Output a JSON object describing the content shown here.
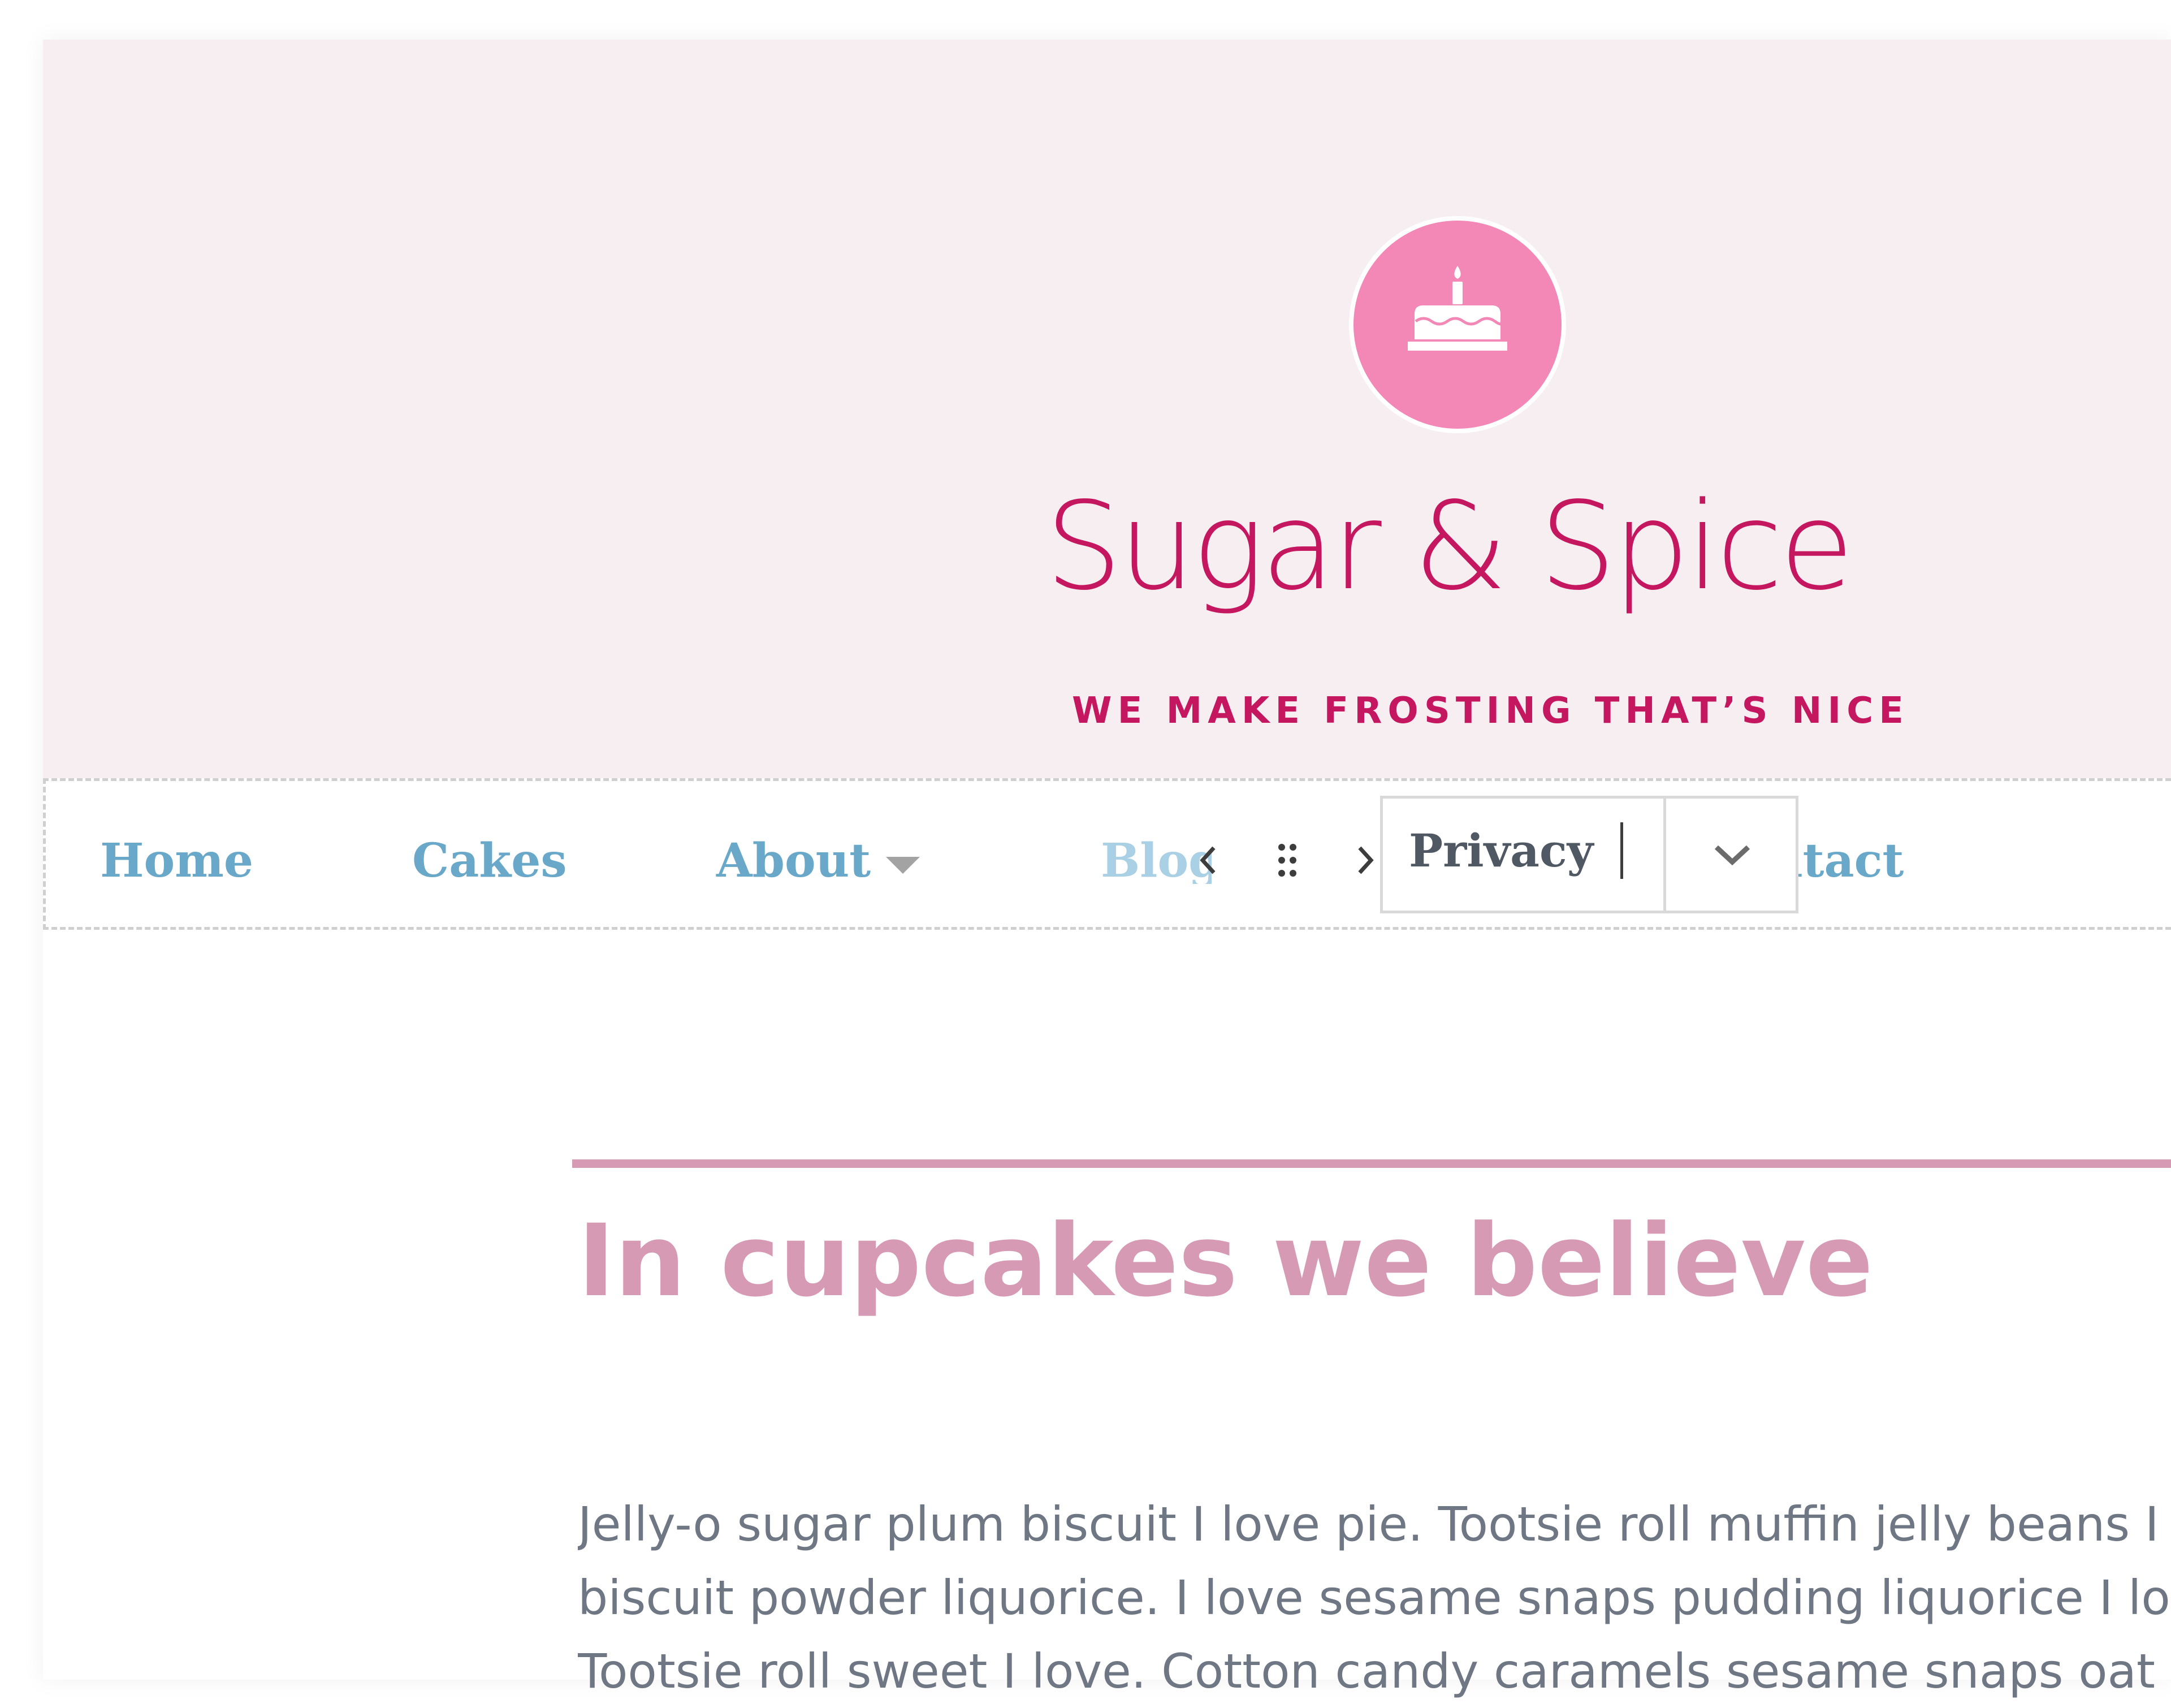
{
  "site": {
    "title": "Sugar & Spice",
    "tagline": "WE MAKE FROSTING THAT’S NICE",
    "logo_icon": "birthday-cake-icon"
  },
  "nav": {
    "items": [
      {
        "label": "Home"
      },
      {
        "label": "Cakes"
      },
      {
        "label": "About",
        "has_submenu": true
      },
      {
        "label": "Blog"
      },
      {
        "label": "Contact"
      }
    ],
    "editing_link": {
      "label": "Privacy",
      "toolbar_icons": [
        "chevron-left-icon",
        "drag-handle-icon",
        "chevron-right-icon",
        "chevron-down-icon"
      ]
    }
  },
  "content": {
    "heading": "In cupcakes we believe",
    "paragraph_lines": [
      "Jelly-o sugar plum biscuit I love pie. Tootsie roll muffin jelly beans I l",
      "biscuit powder liquorice. I love sesame snaps pudding liquorice I lov",
      "Tootsie roll sweet I love. Cotton candy caramels sesame snaps oat c"
    ]
  },
  "colors": {
    "brand": "#c4175f",
    "hero_background": "#f7eef2",
    "logo_circle": "#f387b6",
    "nav_link": "#6aa8c9",
    "heading": "#d79ab5",
    "body_text": "#6e7783"
  }
}
